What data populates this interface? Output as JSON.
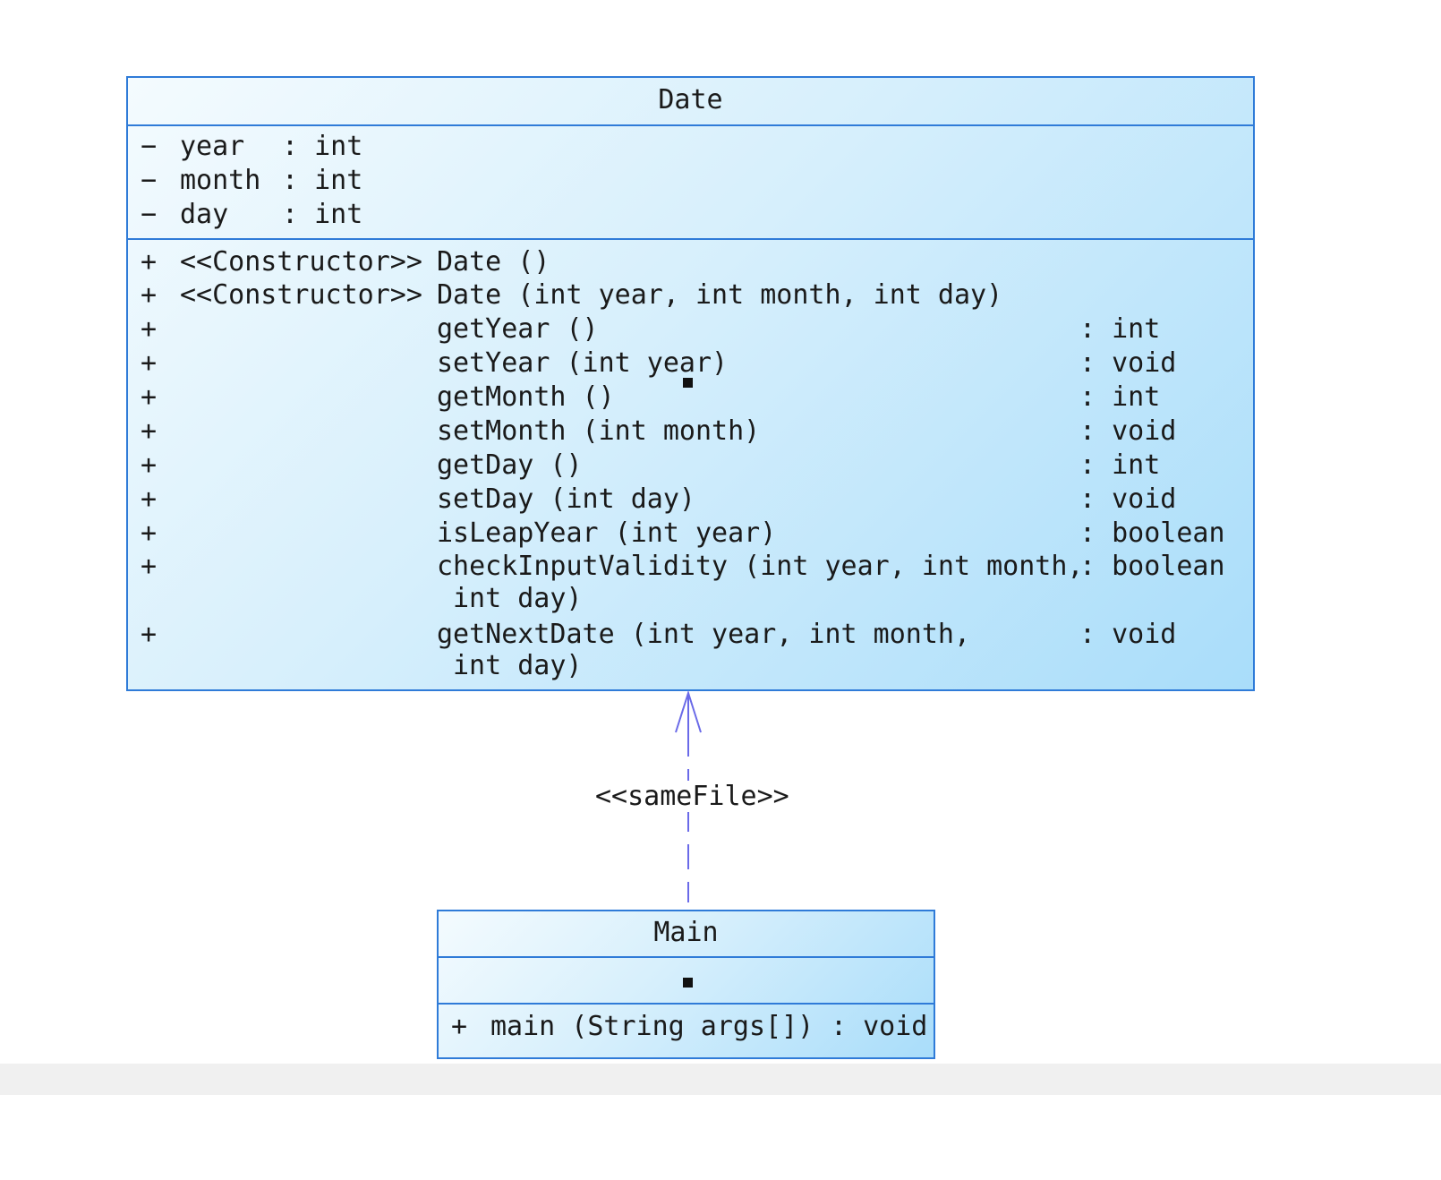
{
  "date_class": {
    "name": "Date",
    "attributes": [
      {
        "visibility": "−",
        "name": "year",
        "type": ": int"
      },
      {
        "visibility": "−",
        "name": "month",
        "type": ": int"
      },
      {
        "visibility": "−",
        "name": "day",
        "type": ": int"
      }
    ],
    "operations": [
      {
        "visibility": "+",
        "stereotype": "<<Constructor>>",
        "signature": "Date ()",
        "type": ""
      },
      {
        "visibility": "+",
        "stereotype": "<<Constructor>>",
        "signature": "Date (int year, int month, int day)",
        "type": ""
      },
      {
        "visibility": "+",
        "stereotype": "",
        "signature": "getYear ()",
        "type": ": int"
      },
      {
        "visibility": "+",
        "stereotype": "",
        "signature": "setYear (int year)",
        "type": ": void"
      },
      {
        "visibility": "+",
        "stereotype": "",
        "signature": "getMonth ()",
        "type": ": int"
      },
      {
        "visibility": "+",
        "stereotype": "",
        "signature": "setMonth (int month)",
        "type": ": void"
      },
      {
        "visibility": "+",
        "stereotype": "",
        "signature": "getDay ()",
        "type": ": int"
      },
      {
        "visibility": "+",
        "stereotype": "",
        "signature": "setDay (int day)",
        "type": ": void"
      },
      {
        "visibility": "+",
        "stereotype": "",
        "signature": "isLeapYear (int year)",
        "type": ": boolean"
      },
      {
        "visibility": "+",
        "stereotype": "",
        "signature": "checkInputValidity (int year, int month,",
        "type": ": boolean"
      },
      {
        "visibility": "+",
        "stereotype": "",
        "signature": "getNextDate (int year, int month,",
        "type": ": void"
      }
    ],
    "continuations": [
      "int day)",
      "int day)"
    ]
  },
  "relationship": {
    "stereotype": "<<sameFile>>"
  },
  "main_class": {
    "name": "Main",
    "operations": [
      {
        "visibility": "+",
        "signature": "main (String args[])",
        "type": ": void"
      }
    ]
  }
}
